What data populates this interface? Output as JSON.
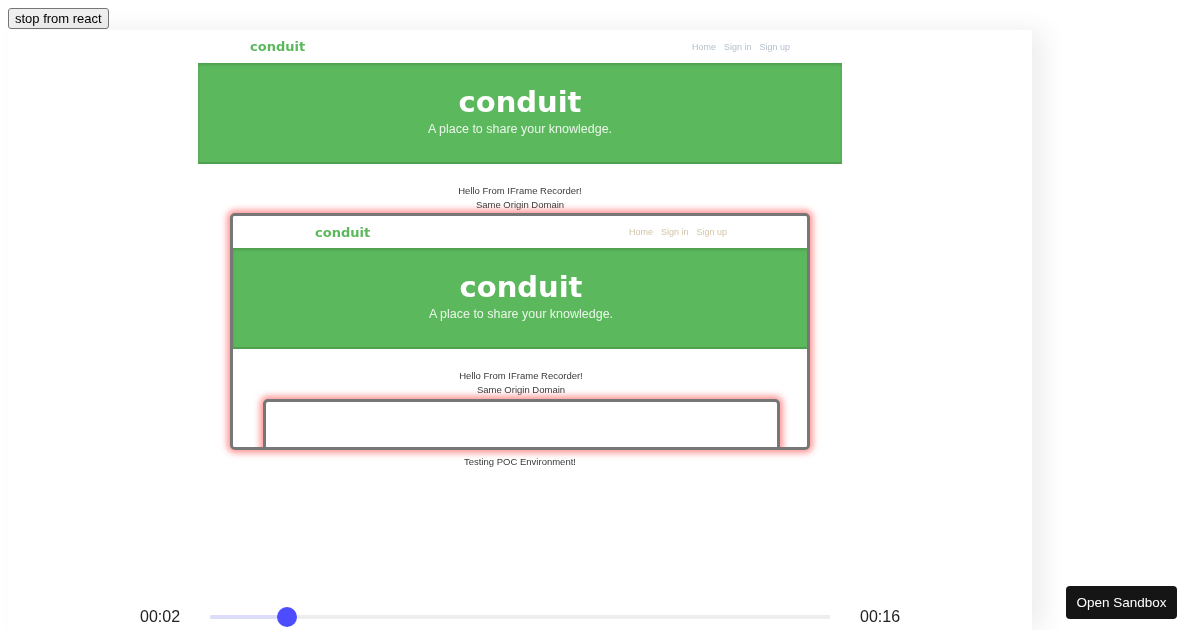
{
  "stop_button": "stop from react",
  "page": {
    "brand": "conduit",
    "nav": [
      "Home",
      "Sign in",
      "Sign up"
    ],
    "banner": {
      "title": "conduit",
      "subtitle": "A place to share your knowledge."
    },
    "lines": [
      "Hello From IFrame Recorder!",
      "Same Origin Domain"
    ],
    "frame": {
      "kind": "frame",
      "page": {
        "brand": "conduit",
        "nav": [
          "Home",
          "Sign in",
          "Sign up"
        ],
        "banner": {
          "title": "conduit",
          "subtitle": "A place to share your knowledge."
        },
        "lines": [
          "Hello From IFrame Recorder!",
          "Same Origin Domain"
        ],
        "frame": {
          "kind": "frame"
        }
      }
    },
    "after_text": "Testing POC Environment!"
  },
  "player": {
    "elapsed": "00:02",
    "level": 0.124,
    "duration": "00:16"
  },
  "sandbox_button": "Open Sandbox"
}
